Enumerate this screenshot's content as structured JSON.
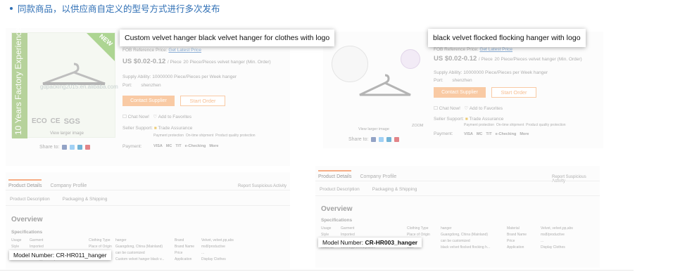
{
  "intro": {
    "text": "同款商品，以供应商自定义的型号方式进行多次发布"
  },
  "listing1": {
    "callout_title": "Custom velvet hanger black velvet hanger for clothes with logo",
    "image": {
      "strip_text": "10 Years Factory Experience",
      "new_badge": "NEW",
      "watermark": "gdpacking2015.en.alibaba.com",
      "badges": [
        "ECO",
        "CE",
        "SGS"
      ],
      "caption": "View larger image"
    },
    "share_label": "Share to:",
    "fob_label": "FOB Reference Price:",
    "fob_link": "Get Latest Price",
    "price": "US $0.02-0.12",
    "price_unit": "/ Piece",
    "moq": "20 Piece/Pieces velvet hanger (Min. Order)",
    "supply_label": "Supply Ability:",
    "supply_value": "10000000 Piece/Pieces per Week hanger",
    "port_label": "Port:",
    "port_value": "shenzhen",
    "contact_button": "Contact Supplier",
    "order_button": "Start Order",
    "chat_label": "Chat Now!",
    "favorites_label": "Add to Favorites",
    "seller_support_label": "Seller Support:",
    "trade_assurance": "Trade Assurance",
    "assurance_items": [
      "Payment protection",
      "On-time shipment",
      "Product quality protection"
    ],
    "payment_label": "Payment:",
    "payment_methods": [
      "VISA",
      "MC",
      "T/T",
      "e-Checking",
      "More"
    ],
    "tabs": [
      "Product Details",
      "Company Profile"
    ],
    "subtabs": [
      "Product Description",
      "Packaging & Shipping"
    ],
    "report": "Report Suspicious Activity",
    "overview": "Overview",
    "specifications": "Specifications",
    "spec_rows": [
      [
        "Usage",
        "Garment",
        "Clothing Type",
        "hanger",
        "Brand",
        "Velvet, velvet,pp,abs"
      ],
      [
        "Style",
        "Imported",
        "Place of Origin",
        "Guangdong, China (Mainland)",
        "Brand Name",
        "ms8/productive"
      ],
      [
        "Use",
        "velvet hanger",
        "Logo",
        "can be customized",
        "Price",
        "..."
      ],
      [
        "Material",
        "velvet/pp/wood/plastic",
        "Size",
        "Custom velvet hanger black v...",
        "Application",
        "Display Clothes"
      ]
    ],
    "model_label": "Model Number:",
    "model_value": "CR-HR011_hanger"
  },
  "listing2": {
    "callout_title": "black velvet flocked flocking hanger with logo",
    "caption": "View larger image",
    "zoom": "ZOOM",
    "share_label": "Share to:",
    "fob_label": "FOB Reference Price:",
    "fob_link": "Get Latest Price",
    "price": "US $0.02-0.12",
    "price_unit": "/ Piece",
    "moq": "20 Piece/Pieces velvet hanger (Min. Order)",
    "supply_label": "Supply Ability:",
    "supply_value": "10000000 Piece/Pieces per Week hanger",
    "port_label": "Port:",
    "port_value": "shenzhen",
    "contact_button": "Contact Supplier",
    "order_button": "Start Order",
    "chat_label": "Chat Now!",
    "favorites_label": "Add to Favorites",
    "seller_support_label": "Seller Support:",
    "trade_assurance": "Trade Assurance",
    "assurance_items": [
      "Payment protection",
      "On-time shipment",
      "Product quality protection"
    ],
    "payment_label": "Payment:",
    "payment_methods": [
      "VISA",
      "MC",
      "T/T",
      "e-Checking",
      "More"
    ],
    "tabs": [
      "Product Details",
      "Company Profile"
    ],
    "subtabs": [
      "Product Description",
      "Packaging & Shipping"
    ],
    "report": "Report Suspicious Activity",
    "overview": "Overview",
    "specifications": "Specifications",
    "spec_rows": [
      [
        "Usage",
        "Garment",
        "Clothing Type",
        "hanger",
        "Material",
        "Velvet, velvet,pp,abs"
      ],
      [
        "Style",
        "Imported",
        "Place of Origin",
        "Guangdong, China (Mainland)",
        "Brand Name",
        "ms8/productive"
      ],
      [
        "Use",
        "velvet hanger",
        "Logo",
        "can be customized",
        "Price",
        "..."
      ],
      [
        "Material",
        "velvet/pp/wood/plastic",
        "Size",
        "black velvet flocked flocking h...",
        "Application",
        "Display Clothes"
      ]
    ],
    "model_label": "Model Number:",
    "model_value": "CR-HR003_hanger"
  },
  "colors": {
    "accent": "#f26a20",
    "orange_button": "#f5a05a",
    "intro_blue": "#2f6fb5",
    "green": "#7cae4a"
  },
  "icons": [
    "bullet-icon",
    "hanger-icon",
    "facebook-icon",
    "twitter-icon",
    "linkedin-icon",
    "pinterest-icon",
    "mail-icon",
    "chat-icon",
    "heart-icon",
    "shield-icon"
  ]
}
